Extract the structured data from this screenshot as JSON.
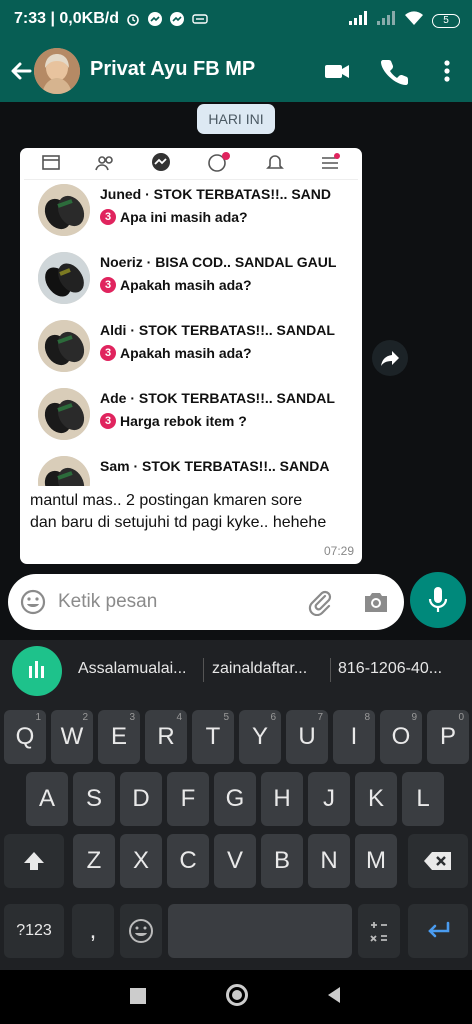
{
  "status": {
    "time_speed": "7:33 | 0,0KB/d",
    "battery": "5"
  },
  "header": {
    "contact_name": "Privat Ayu FB MP"
  },
  "chat": {
    "date_chip": "HARI INI",
    "caption": "mantul mas.. 2 postingan kmaren sore dan baru di setujuhi td pagi kyke.. hehehe",
    "time": "07:29",
    "conversations": [
      {
        "name": "Juned · STOK TERBATAS!!.. SAND",
        "badge": "3",
        "message": "Apa ini masih ada?"
      },
      {
        "name": "Noeriz · BISA COD.. SANDAL GAUL",
        "badge": "3",
        "message": "Apakah masih ada?"
      },
      {
        "name": "Aldi · STOK TERBATAS!!.. SANDAL",
        "badge": "3",
        "message": "Apakah masih ada?"
      },
      {
        "name": "Ade · STOK TERBATAS!!.. SANDAL",
        "badge": "3",
        "message": "Harga rebok item ?"
      },
      {
        "name": "Sam · STOK TERBATAS!!.. SANDA",
        "badge": "",
        "message": ""
      }
    ]
  },
  "input": {
    "placeholder": "Ketik pesan"
  },
  "keyboard": {
    "suggestions": [
      "Assalamualai...",
      "zainaldaftar...",
      "816-1206-40..."
    ],
    "row1": [
      {
        "k": "Q",
        "h": "1"
      },
      {
        "k": "W",
        "h": "2"
      },
      {
        "k": "E",
        "h": "3"
      },
      {
        "k": "R",
        "h": "4"
      },
      {
        "k": "T",
        "h": "5"
      },
      {
        "k": "Y",
        "h": "6"
      },
      {
        "k": "U",
        "h": "7"
      },
      {
        "k": "I",
        "h": "8"
      },
      {
        "k": "O",
        "h": "9"
      },
      {
        "k": "P",
        "h": "0"
      }
    ],
    "row2": [
      "A",
      "S",
      "D",
      "F",
      "G",
      "H",
      "J",
      "K",
      "L"
    ],
    "row3": [
      "Z",
      "X",
      "C",
      "V",
      "B",
      "N",
      "M"
    ],
    "symbols_label": "?123",
    "comma_label": ","
  },
  "icon_names": [
    "back-arrow-icon",
    "video-call-icon",
    "phone-icon",
    "more-vert-icon",
    "emoji-icon",
    "attach-icon",
    "camera-icon",
    "mic-icon",
    "forward-icon",
    "shift-icon",
    "backspace-icon",
    "enter-icon"
  ]
}
